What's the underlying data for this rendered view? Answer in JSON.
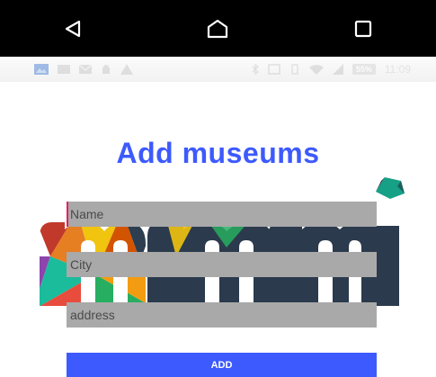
{
  "navbar": {
    "icons": [
      "back-icon",
      "home-icon",
      "recents-icon"
    ]
  },
  "statusbar": {
    "left_icons": [
      "gallery-icon",
      "notification-icon",
      "mail-icon",
      "android-icon",
      "warning-icon"
    ],
    "right_icons": [
      "bluetooth-icon",
      "nfc-icon",
      "vibrate-icon",
      "wifi-icon",
      "signal-icon"
    ],
    "battery": "55%",
    "time": "11:09"
  },
  "page": {
    "title": "Add museums"
  },
  "form": {
    "name_placeholder": "Name",
    "city_placeholder": "City",
    "address_placeholder": "address",
    "add_label": "ADD"
  },
  "colors": {
    "accent": "#3d5afe",
    "field_bg": "#a9a9a9",
    "logo_dark": "#2b3a4c"
  }
}
